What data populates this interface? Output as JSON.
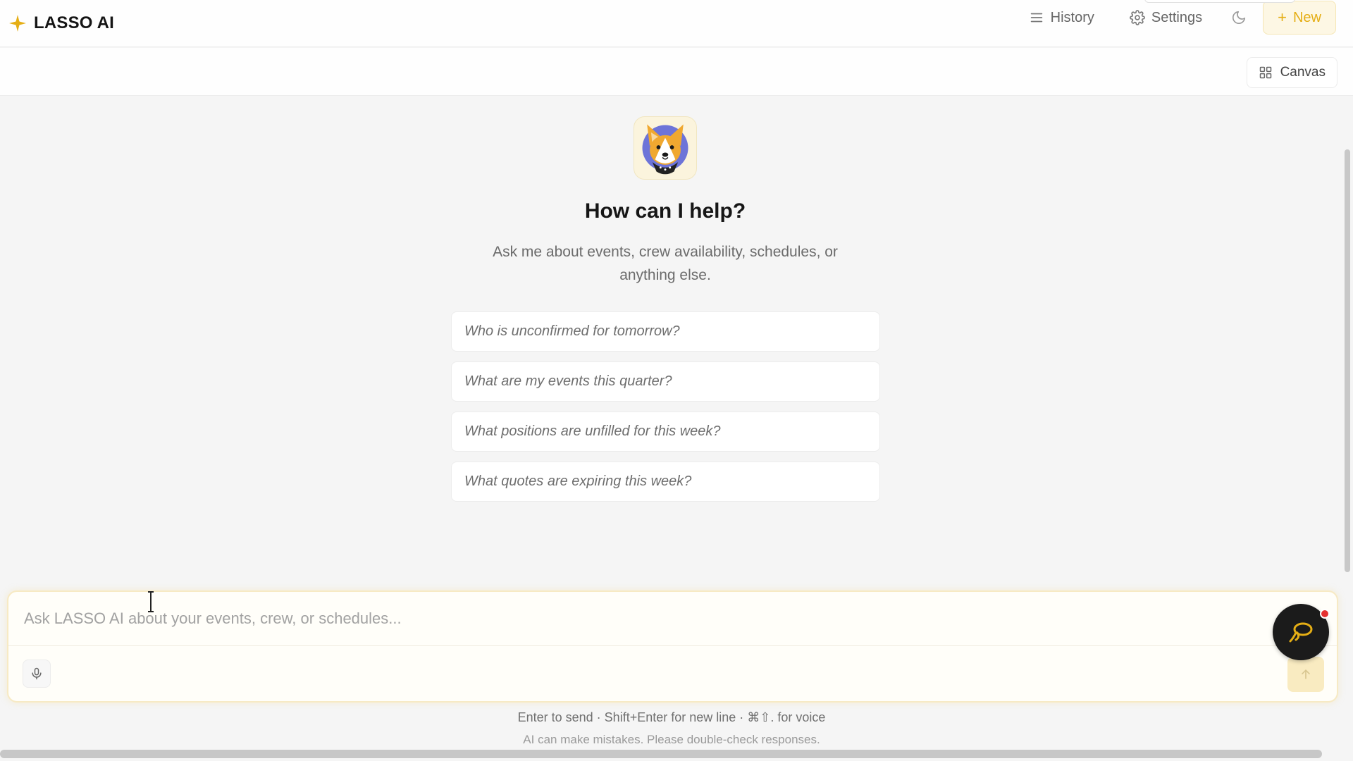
{
  "app": {
    "name": "LASSO AI",
    "accent_color": "#E5AE15"
  },
  "header": {
    "history_label": "History",
    "settings_label": "Settings",
    "new_label": "New",
    "icons": {
      "brand": "sparkle-star-icon",
      "history": "menu-lines-icon",
      "settings": "gear-icon",
      "theme": "moon-icon",
      "new": "plus-icon"
    }
  },
  "subbar": {
    "canvas_label": "Canvas",
    "canvas_icon": "grid-icon"
  },
  "main": {
    "avatar_icon": "corgi-mascot-icon",
    "heading": "How can I help?",
    "subtext": "Ask me about events, crew availability, schedules, or anything else.",
    "suggestions": [
      "Who is unconfirmed for tomorrow?",
      "What are my events this quarter?",
      "What positions are unfilled for this week?",
      "What quotes are expiring this week?"
    ]
  },
  "composer": {
    "placeholder": "Ask LASSO AI about your events, crew, or schedules...",
    "value": "",
    "mic_icon": "microphone-icon",
    "send_icon": "arrow-up-icon",
    "assistant_icon": "lasso-loop-icon"
  },
  "footer": {
    "hint": "Enter to send · Shift+Enter for new line · ⌘⇧. for voice",
    "disclaimer": "AI can make mistakes. Please double-check responses."
  }
}
